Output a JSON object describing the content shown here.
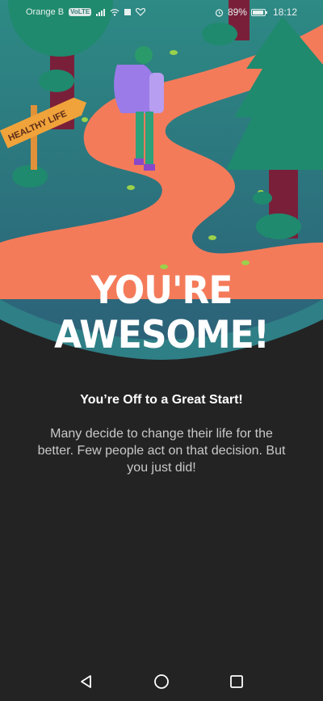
{
  "status_bar": {
    "carrier": "Orange B",
    "volte_badge": "VoLTE",
    "battery_percent": "89%",
    "time": "18:12",
    "icons": [
      "signal-icon",
      "wifi-icon",
      "square-icon",
      "heart-rate-icon",
      "alarm-icon",
      "battery-icon"
    ]
  },
  "hero": {
    "sign_text": "HEALTHY LIFE",
    "headline": "YOU'RE AWESOME!",
    "colors": {
      "sky_teal": "#2f8f89",
      "grass_dark": "#2b5e73",
      "path_orange": "#f47b5a",
      "tree_green": "#1f8a6e",
      "trunk": "#7a1f3a",
      "sign_orange": "#f0a33a"
    }
  },
  "content": {
    "subtitle": "You’re Off to a Great Start!",
    "body": "Many decide to change their life for the better. Few people act on that decision. But you just did!"
  },
  "nav": {
    "buttons": [
      "back-icon",
      "home-icon",
      "recents-icon"
    ]
  }
}
